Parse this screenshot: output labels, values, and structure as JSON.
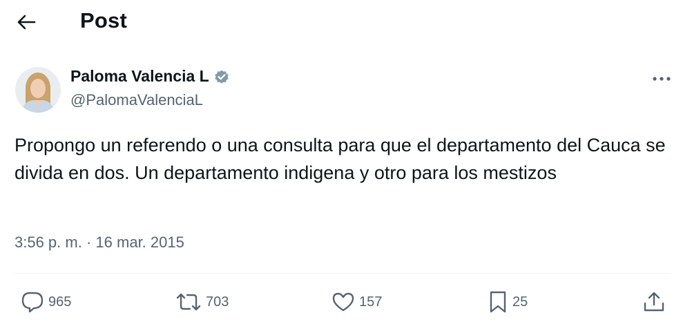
{
  "header": {
    "title": "Post",
    "back_icon": "arrow-left-icon"
  },
  "author": {
    "display_name": "Paloma Valencia L",
    "handle": "@PalomaValenciaL",
    "verified_icon": "verified-badge-icon",
    "verified_color": "#829aab"
  },
  "tweet": {
    "text": "Propongo un referendo o una consulta para que el departamento del Cauca se divida en dos. Un departamento indigena y otro para los mestizos",
    "time": "3:56 p. m.",
    "separator": "·",
    "date": "16 mar. 2015"
  },
  "actions": {
    "replies": {
      "icon": "reply-icon",
      "count": "965"
    },
    "reposts": {
      "icon": "repost-icon",
      "count": "703"
    },
    "likes": {
      "icon": "heart-icon",
      "count": "157"
    },
    "bookmarks": {
      "icon": "bookmark-icon",
      "count": "25"
    },
    "share": {
      "icon": "share-icon"
    }
  },
  "colors": {
    "text_primary": "#0f1419",
    "text_secondary": "#536471",
    "divider": "#eff3f4"
  }
}
